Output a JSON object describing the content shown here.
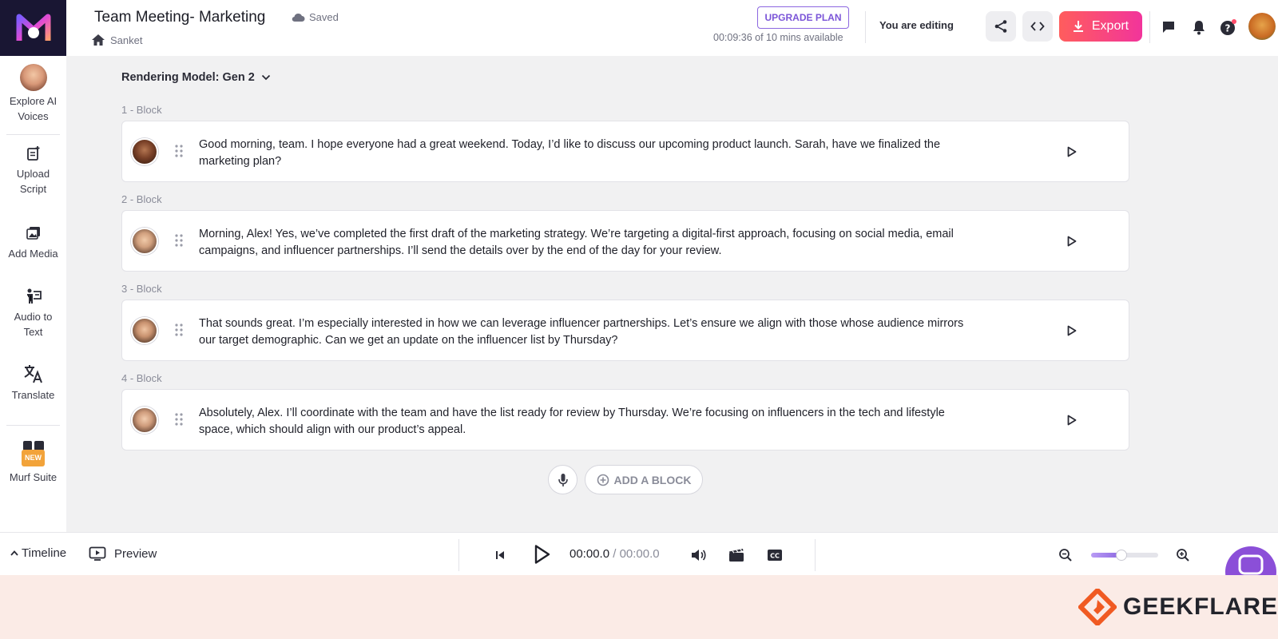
{
  "header": {
    "project_title": "Team Meeting- Marketing",
    "save_status": "Saved",
    "breadcrumb": "Sanket",
    "upgrade_label": "UPGRADE PLAN",
    "usage": "00:09:36 of 10 mins available",
    "editing_status": "You are editing",
    "export_label": "Export"
  },
  "sidebar": {
    "items": [
      {
        "label": "Explore AI Voices",
        "icon": "avatar-face"
      },
      {
        "label": "Upload Script",
        "icon": "upload-script-icon"
      },
      {
        "label": "Add Media",
        "icon": "add-media-icon"
      },
      {
        "label": "Audio to Text",
        "icon": "audio-to-text-icon"
      },
      {
        "label": "Translate",
        "icon": "translate-icon"
      },
      {
        "label": "Murf Suite",
        "icon": "suite-grid-icon",
        "badge": "NEW"
      }
    ]
  },
  "editor": {
    "rendering_model": "Rendering Model: Gen 2",
    "blocks": [
      {
        "label": "1 -  Block",
        "text": "Good morning, team. I hope everyone had a great weekend. Today, I’d like to discuss our upcoming product launch. Sarah, have we finalized the marketing plan?"
      },
      {
        "label": "2 -  Block",
        "text": "Morning, Alex! Yes, we’ve completed the first draft of the marketing strategy. We’re targeting a digital-first approach, focusing on social media, email campaigns, and influencer partnerships. I’ll send the details over by the end of the day for your review."
      },
      {
        "label": "3 -  Block",
        "text": "That sounds great. I’m especially interested in how we can leverage influencer partnerships. Let’s ensure we align with those whose audience mirrors our target demographic. Can we get an update on the influencer list by Thursday?"
      },
      {
        "label": "4 -  Block",
        "text": "Absolutely, Alex. I’ll coordinate with the team and have the list ready for review by Thursday. We’re focusing on influencers in the tech and lifestyle space, which should align with our product’s appeal."
      }
    ],
    "add_block_label": "ADD A BLOCK"
  },
  "player": {
    "timeline_label": "Timeline",
    "preview_label": "Preview",
    "current_time": "00:00.0",
    "separator": " / ",
    "duration": "00:00.0",
    "zoom_level": 0.45
  },
  "watermark": {
    "brand": "GEEKFLARE"
  },
  "colors": {
    "accent": "#8c67e0",
    "export_start": "#ff5d5d",
    "export_end": "#f2349b",
    "sidebar_bg": "#ffffff",
    "logo_bg": "#191633"
  }
}
